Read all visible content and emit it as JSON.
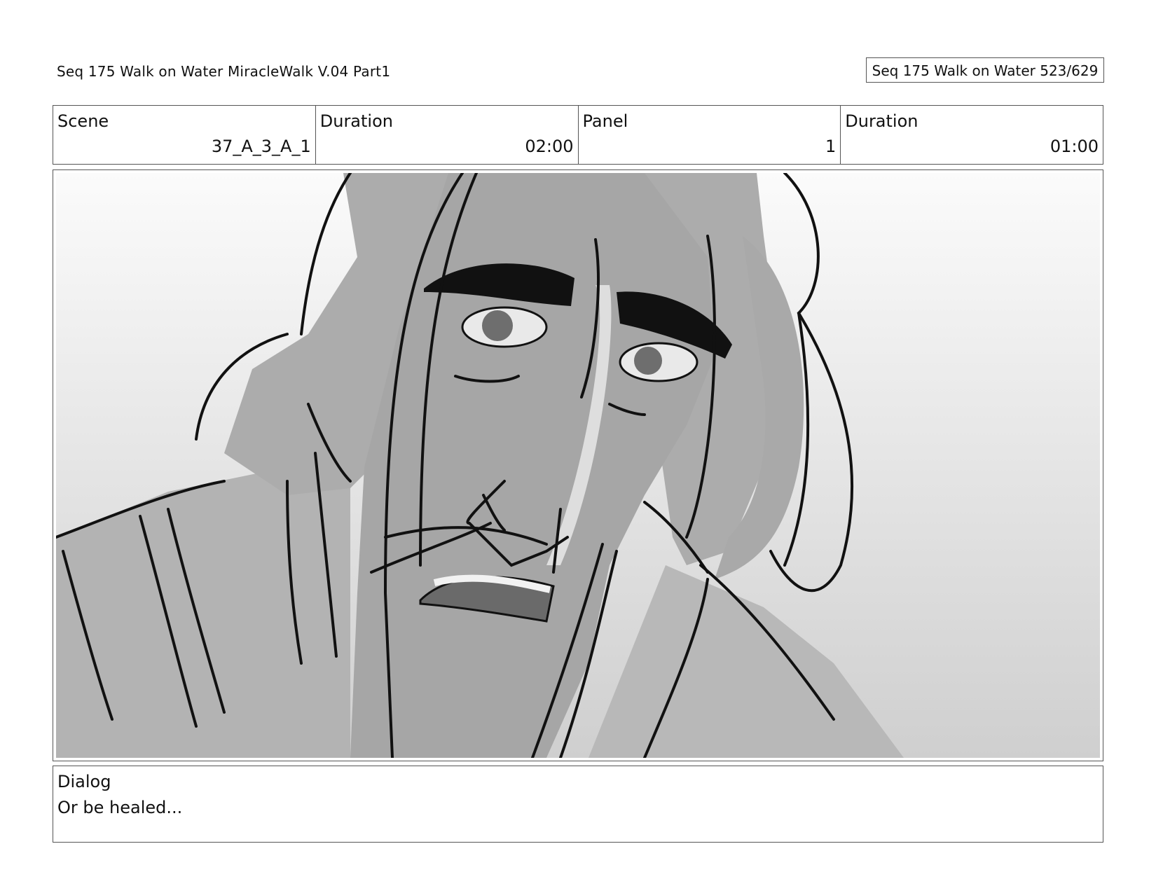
{
  "header": {
    "title": "Seq 175 Walk on Water  MiracleWalk V.04 Part1",
    "page_indicator": "Seq 175 Walk on Water 523/629"
  },
  "info": {
    "scene_label": "Scene",
    "scene_value": "37_A_3_A_1",
    "scene_duration_label": "Duration",
    "scene_duration_value": "02:00",
    "panel_label": "Panel",
    "panel_value": "1",
    "panel_duration_label": "Duration",
    "panel_duration_value": "01:00"
  },
  "dialog": {
    "label": "Dialog",
    "text": "Or be healed..."
  }
}
